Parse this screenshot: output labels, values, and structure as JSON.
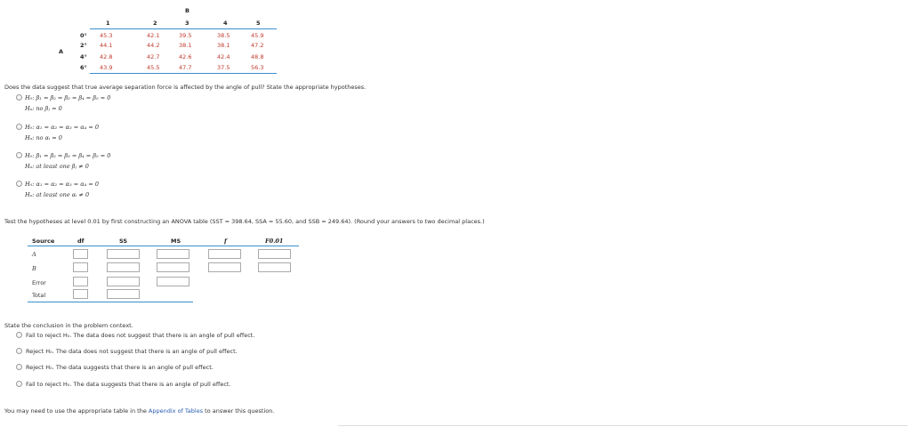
{
  "factor_table": {
    "b_label": "B",
    "a_label": "A",
    "col_headers": [
      "1",
      "2",
      "3",
      "4",
      "5"
    ],
    "rows": [
      {
        "label": "0°",
        "values": [
          "45.3",
          "42.1",
          "39.5",
          "38.5",
          "45.9"
        ]
      },
      {
        "label": "2°",
        "values": [
          "44.1",
          "44.2",
          "38.1",
          "38.1",
          "47.2"
        ]
      },
      {
        "label": "4°",
        "values": [
          "42.8",
          "42.7",
          "42.6",
          "42.4",
          "48.8"
        ]
      },
      {
        "label": "6°",
        "values": [
          "43.9",
          "45.5",
          "47.7",
          "37.5",
          "56.3"
        ]
      }
    ]
  },
  "question1": "Does the data suggest that true average separation force is affected by the angle of pull? State the appropriate hypotheses.",
  "hyp_options": [
    {
      "h0": "H₀: β₁ = β₂ = β₃ = β₄ = β₅ = 0",
      "ha": "Hₐ: no βⱼ = 0"
    },
    {
      "h0": "H₀: α₁ = α₂ = α₃ = α₄ = 0",
      "ha": "Hₐ: no αᵢ = 0"
    },
    {
      "h0": "H₀: β₁ = β₂ = β₃ = β₄ = β₅ = 0",
      "ha": "Hₐ: at least one βⱼ ≠ 0"
    },
    {
      "h0": "H₀: α₁ = α₂ = α₃ = α₄ = 0",
      "ha": "Hₐ: at least one αᵢ ≠ 0"
    }
  ],
  "question2": "Test the hypotheses at level 0.01 by first constructing an ANOVA table (SST = 398.64, SSA = 55.60, and SSB = 249.64). (Round your answers to two decimal places.)",
  "anova": {
    "headers": {
      "source": "Source",
      "df": "df",
      "ss": "SS",
      "ms": "MS",
      "f": "f",
      "fcrit": "F0.01"
    },
    "rows": [
      "A",
      "B",
      "Error",
      "Total"
    ]
  },
  "question3": "State the conclusion in the problem context.",
  "conclusions": [
    "Fail to reject H₀. The data does not suggest that there is an angle of pull effect.",
    "Reject H₀. The data does not suggest that there is an angle of pull effect.",
    "Reject H₀. The data suggests that there is an angle of pull effect.",
    "Fail to reject H₀. The data suggests that there is an angle of pull effect."
  ],
  "footer": {
    "before": "You may need to use the appropriate table in the ",
    "link": "Appendix of Tables",
    "after": " to answer this question."
  }
}
